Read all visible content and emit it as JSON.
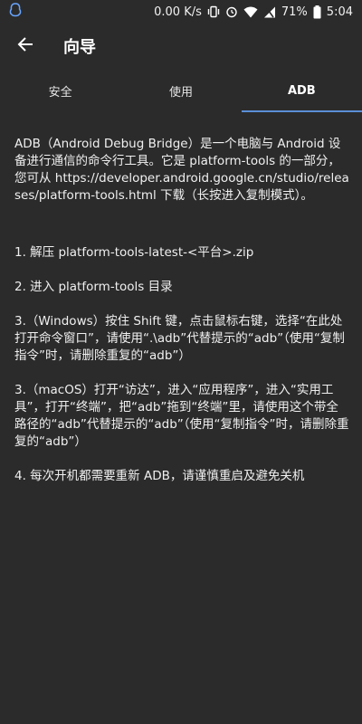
{
  "status_bar": {
    "speed": "0.00 K/s",
    "battery": "71%",
    "time": "5:04"
  },
  "header": {
    "title": "向导"
  },
  "tabs": [
    {
      "label": "安全",
      "active": false
    },
    {
      "label": "使用",
      "active": false
    },
    {
      "label": "ADB",
      "active": true
    }
  ],
  "content": {
    "intro": "ADB（Android Debug Bridge）是一个电脑与 Android 设备进行通信的命令行工具。它是 platform-tools 的一部分，您可从 https://developer.android.google.cn/studio/releases/platform-tools.html 下载（长按进入复制模式）。",
    "steps": [
      "1. 解压 platform-tools-latest-<平台>.zip",
      "2. 进入 platform-tools 目录",
      "3.（Windows）按住 Shift 键，点击鼠标右键，选择“在此处打开命令窗口”，请使用“.\\adb”代替提示的“adb”（使用“复制指令”时，请删除重复的“adb”）",
      "3.（macOS）打开“访达”，进入“应用程序”，进入“实用工具”，打开“终端”，把“adb”拖到“终端”里，请使用这个带全路径的“adb”代替提示的“adb”（使用“复制指令”时，请删除重复的“adb”）",
      "4. 每次开机都需要重新 ADB，请谨慎重启及避免关机"
    ]
  }
}
